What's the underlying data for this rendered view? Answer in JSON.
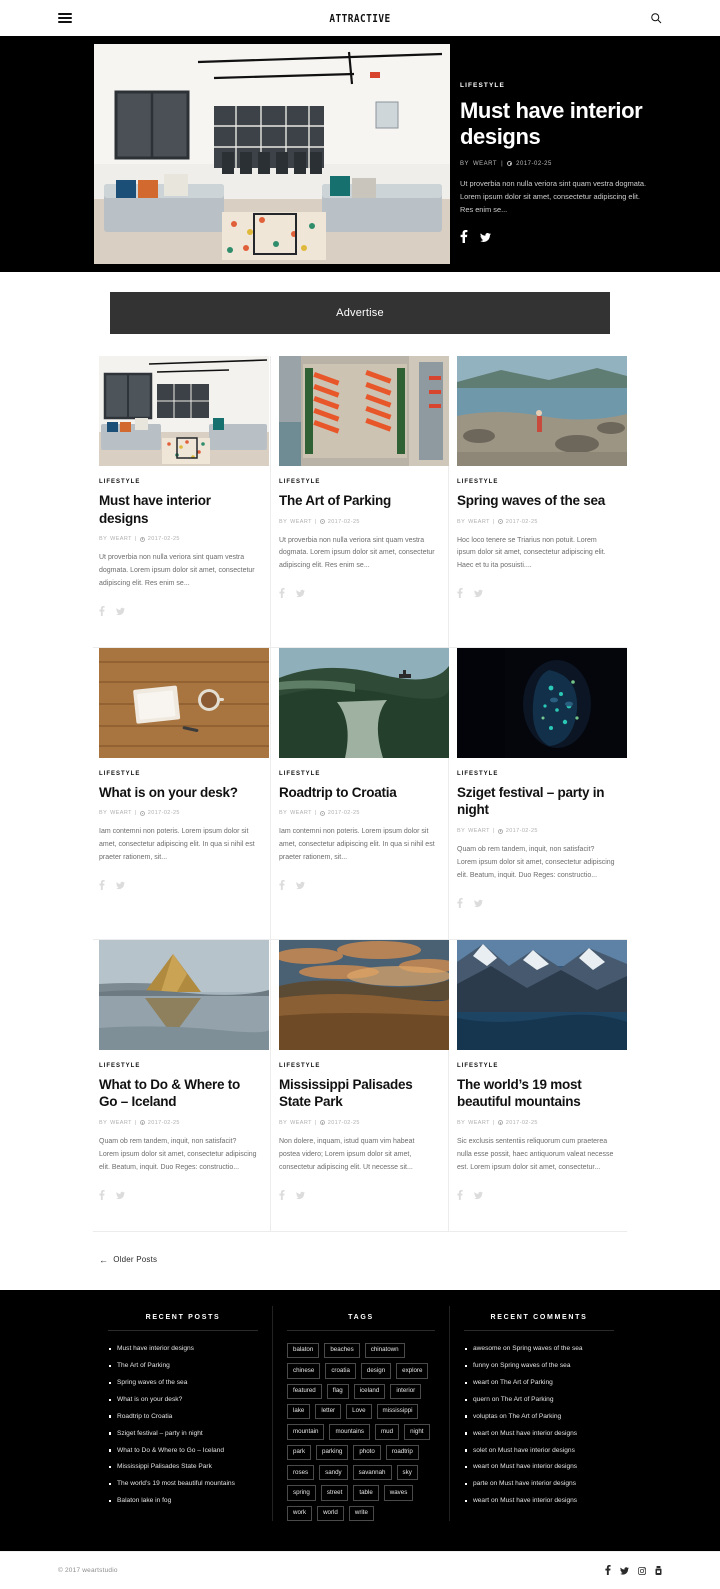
{
  "header": {
    "brand": "ATTRACTIVE",
    "menu_icon": "hamburger-menu-icon",
    "search_icon": "search-icon"
  },
  "hero": {
    "category": "LIFESTYLE",
    "title": "Must have interior designs",
    "author_prefix": "BY",
    "author": "WEART",
    "separator": "|",
    "date": "2017-02-25",
    "excerpt": "Ut proverbia non nulla veriora sint quam vestra dogmata. Lorem ipsum dolor sit amet, consectetur adipiscing elit. Res enim se...",
    "social": [
      "facebook-icon",
      "twitter-icon"
    ],
    "image_alt": "modern white loft living room with grey sofas and dining table"
  },
  "advertise": {
    "label": "Advertise"
  },
  "grid": {
    "meta_author_prefix": "BY",
    "meta_author": "WEART",
    "meta_separator": "|",
    "meta_date": "2017-02-25",
    "cards": [
      {
        "category": "LIFESTYLE",
        "title": "Must have interior designs",
        "excerpt": "Ut proverbia non nulla veriora sint quam vestra dogmata. Lorem ipsum dolor sit amet, consectetur adipiscing elit. Res enim se...",
        "image_alt": "white loft interior with grey sofa and colorful rug"
      },
      {
        "category": "LIFESTYLE",
        "title": "The Art of Parking",
        "excerpt": "Ut proverbia non nulla veriora sint quam vestra dogmata. Lorem ipsum dolor sit amet, consectetur adipiscing elit. Res enim se...",
        "image_alt": "aerial view of parking lot with orange cars"
      },
      {
        "category": "LIFESTYLE",
        "title": "Spring waves of the sea",
        "excerpt": "Hoc loco tenere se Triarius non potuit. Lorem ipsum dolor sit amet, consectetur adipiscing elit. Haec et tu ita posuisti....",
        "image_alt": "woman in red dress on rocky coast by the sea"
      },
      {
        "category": "LIFESTYLE",
        "title": "What is on your desk?",
        "excerpt": "Iam contemni non poteris. Lorem ipsum dolor sit amet, consectetur adipiscing elit. In qua si nihil est praeter rationem, sit...",
        "image_alt": "notebook and coffee cup on wooden desk"
      },
      {
        "category": "LIFESTYLE",
        "title": "Roadtrip to Croatia",
        "excerpt": "Iam contemni non poteris. Lorem ipsum dolor sit amet, consectetur adipiscing elit. In qua si nihil est praeter rationem, sit...",
        "image_alt": "forested coastline with sea and ship"
      },
      {
        "category": "LIFESTYLE",
        "title": "Sziget festival – party in night",
        "excerpt": "Quam ob rem tandem, inquit, non satisfacit? Lorem ipsum dolor sit amet, consectetur adipiscing elit. Beatum, inquit. Duo Reges: constructio...",
        "image_alt": "face with neon blue and green paint in the dark"
      },
      {
        "category": "LIFESTYLE",
        "title": "What to Do & Where to Go – Iceland",
        "excerpt": "Quam ob rem tandem, inquit, non satisfacit? Lorem ipsum dolor sit amet, consectetur adipiscing elit. Beatum, inquit. Duo Reges: constructio...",
        "image_alt": "Kirkjufell mountain reflected in water"
      },
      {
        "category": "LIFESTYLE",
        "title": "Mississippi Palisades State Park",
        "excerpt": "Non dolere, inquam, istud quam vim habeat postea videro; Lorem ipsum dolor sit amet, consectetur adipiscing elit. Ut necesse sit...",
        "image_alt": "prairie field with hills and dramatic sunset clouds"
      },
      {
        "category": "LIFESTYLE",
        "title": "The world’s 19 most beautiful mountains",
        "excerpt": "Sic exclusis sententiis reliquorum cum praeterea nulla esse possit, haec antiquorum valeat necesse est. Lorem ipsum dolor sit amet, consectetur...",
        "image_alt": "snowy mountains above a fjord"
      }
    ],
    "card_social": [
      "facebook-icon",
      "twitter-icon"
    ]
  },
  "pagination": {
    "older_label": "Older Posts",
    "arrow": "←"
  },
  "footer": {
    "recent_posts": {
      "title": "RECENT POSTS",
      "items": [
        "Must have interior designs",
        "The Art of Parking",
        "Spring waves of the sea",
        "What is on your desk?",
        "Roadtrip to Croatia",
        "Sziget festival – party in night",
        "What to Do & Where to Go – Iceland",
        "Mississippi Palisades State Park",
        "The world’s 19 most beautiful mountains",
        "Balaton lake in fog"
      ]
    },
    "tags": {
      "title": "TAGS",
      "items": [
        "balaton",
        "beaches",
        "chinatown",
        "chinese",
        "croatia",
        "design",
        "explore",
        "featured",
        "flag",
        "iceland",
        "interior",
        "lake",
        "letter",
        "Love",
        "mississippi",
        "mountain",
        "mountains",
        "mud",
        "night",
        "park",
        "parking",
        "photo",
        "roadtrip",
        "roses",
        "sandy",
        "savannah",
        "sky",
        "spring",
        "street",
        "table",
        "waves",
        "work",
        "world",
        "write"
      ]
    },
    "recent_comments": {
      "title": "RECENT COMMENTS",
      "items": [
        "awesome on Spring waves of the sea",
        "funny on Spring waves of the sea",
        "weart on The Art of Parking",
        "quern on The Art of Parking",
        "voluptas on The Art of Parking",
        "weart on Must have interior designs",
        "solet on Must have interior designs",
        "weart on Must have interior designs",
        "parte on Must have interior designs",
        "weart on Must have interior designs"
      ]
    }
  },
  "bottom": {
    "copyright": "© 2017 weartstudio",
    "social": [
      "facebook-icon",
      "twitter-icon",
      "instagram-icon",
      "youtube-icon"
    ]
  },
  "colors": {
    "accent_dark": "#000000",
    "ad_bg": "#333333",
    "text": "#111111",
    "muted": "#6d6d6d"
  }
}
